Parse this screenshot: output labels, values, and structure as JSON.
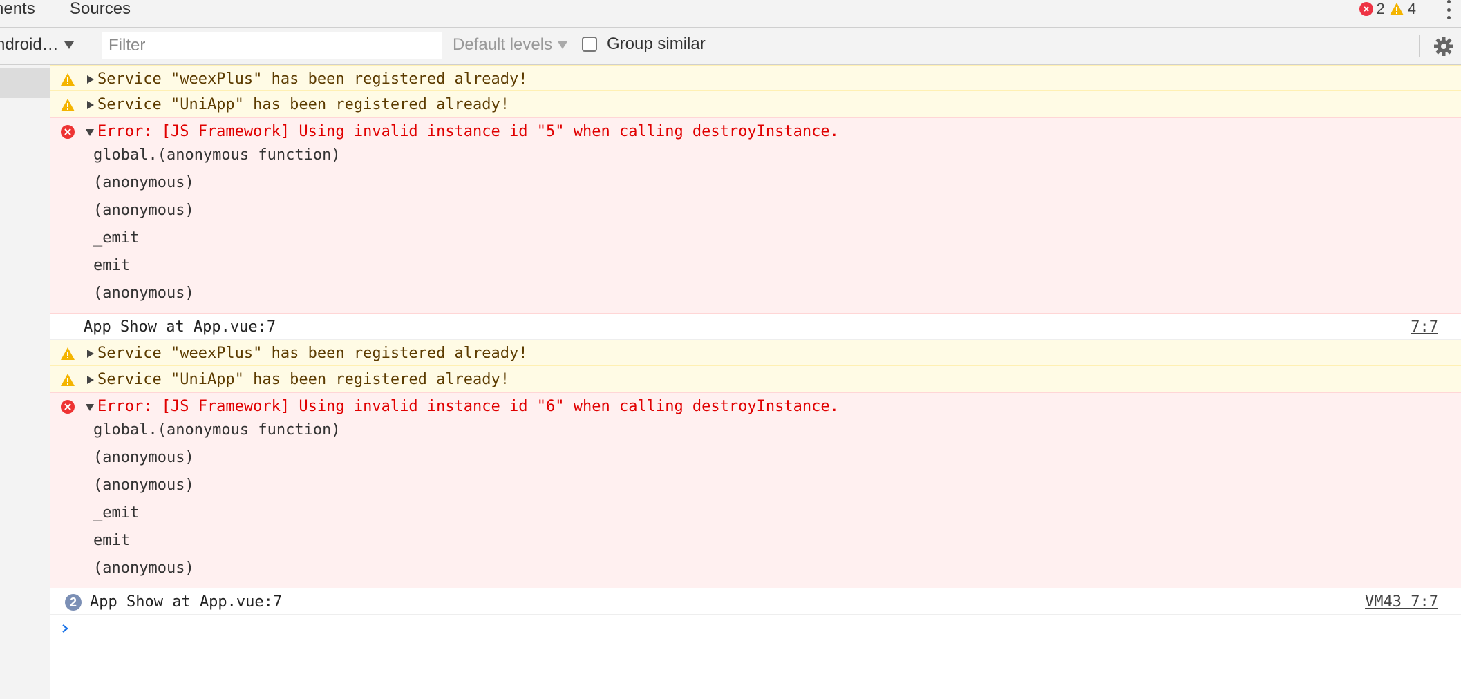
{
  "tabs": {
    "elements_label": "nents",
    "sources_label": "Sources"
  },
  "counters": {
    "errors": "2",
    "warnings": "4"
  },
  "toolbar": {
    "context_label": "ndroid…",
    "filter_placeholder": "Filter",
    "levels_label": "Default levels",
    "group_similar_label": "Group similar"
  },
  "colors": {
    "error": "#e00000",
    "error_bg": "#fff0f0",
    "warning_bg": "#fffbe5",
    "warning_icon": "#f4b400",
    "repeat_badge": "#7b8fb5"
  },
  "console": {
    "warn1": "Service \"weexPlus\" has been registered already!",
    "warn2": "Service \"UniApp\" has been registered already!",
    "error1": {
      "message": "Error: [JS Framework] Using invalid instance id \"5\" when calling destroyInstance.",
      "frames": [
        "global.(anonymous function)",
        "(anonymous)",
        "(anonymous)",
        "_emit",
        "emit",
        "(anonymous)"
      ]
    },
    "info1": {
      "text": "App Show at App.vue:7",
      "link": "7:7"
    },
    "warn3": "Service \"weexPlus\" has been registered already!",
    "warn4": "Service \"UniApp\" has been registered already!",
    "error2": {
      "message": "Error: [JS Framework] Using invalid instance id \"6\" when calling destroyInstance.",
      "frames": [
        "global.(anonymous function)",
        "(anonymous)",
        "(anonymous)",
        "_emit",
        "emit",
        "(anonymous)"
      ]
    },
    "info2": {
      "count": "2",
      "text": "App Show at App.vue:7",
      "link": "VM43 7:7"
    }
  }
}
